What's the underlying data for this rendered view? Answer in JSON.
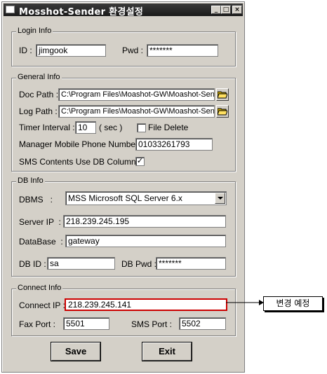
{
  "window": {
    "title": "Mosshot-Sender 환경설정",
    "minimize": "_",
    "maximize": "□",
    "close": "×"
  },
  "login": {
    "legend": "Login Info",
    "id_label": "ID :",
    "id_value": "jimgook",
    "pwd_label": "Pwd :",
    "pwd_value": "*******"
  },
  "general": {
    "legend": "General Info",
    "doc_path_label": "Doc Path :",
    "doc_path_value": "C:\\Program Files\\Moashot-GW\\Moashot-Sen",
    "log_path_label": "Log Path :",
    "log_path_value": "C:\\Program Files\\Moashot-GW\\Moashot-Sen",
    "timer_label": "Timer Interval :",
    "timer_value": "10",
    "timer_unit": "( sec )",
    "file_delete_label": "File Delete",
    "file_delete_checked": false,
    "phone_label": "Manager Mobile Phone Number :",
    "phone_value": "01033261793",
    "sms_db_label": "SMS Contents Use DB Column :",
    "sms_db_checked": true,
    "check_mark": "✓"
  },
  "db": {
    "legend": "DB Info",
    "dbms_label": "DBMS   :",
    "dbms_value": "MSS Microsoft SQL Server 6.x",
    "server_ip_label": "Server IP  :",
    "server_ip_value": "218.239.245.195",
    "database_label": "DataBase  :",
    "database_value": "gateway",
    "dbid_label": "DB ID :",
    "dbid_value": "sa",
    "dbpwd_label": "DB Pwd :",
    "dbpwd_value": "*******"
  },
  "connect": {
    "legend": "Connect Info",
    "ip_label": "Connect IP :",
    "ip_value": "218.239.245.141",
    "fax_label": "Fax Port :",
    "fax_value": "5501",
    "sms_label": "SMS Port :",
    "sms_value": "5502",
    "highlight_color": "#cc0000"
  },
  "buttons": {
    "save": "Save",
    "exit": "Exit"
  },
  "annotation": {
    "callout_text": "변경 예정"
  }
}
